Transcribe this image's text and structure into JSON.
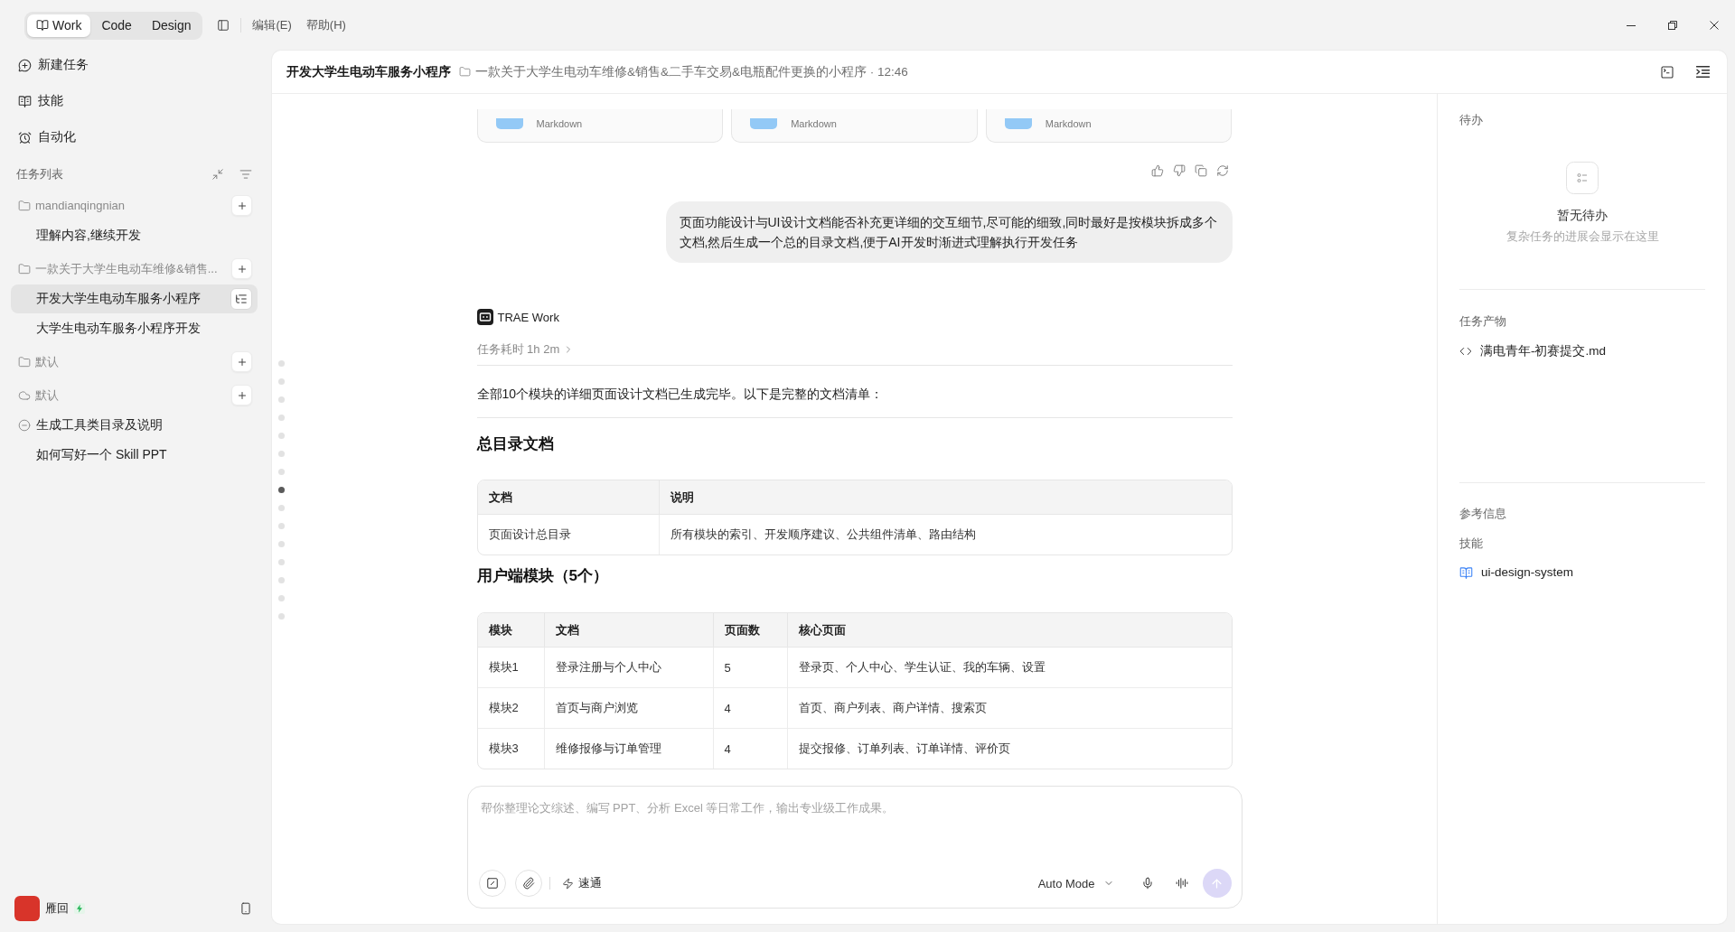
{
  "titlebar": {
    "modes": [
      {
        "label": "Work",
        "selected": true
      },
      {
        "label": "Code",
        "selected": false
      },
      {
        "label": "Design",
        "selected": false
      }
    ],
    "menus": [
      "编辑(E)",
      "帮助(H)"
    ]
  },
  "sidebar": {
    "nav": [
      {
        "label": "新建任务",
        "kind": "new_task"
      },
      {
        "label": "技能",
        "kind": "skills"
      },
      {
        "label": "自动化",
        "kind": "automation"
      }
    ],
    "task_list": {
      "title": "任务列表",
      "groups": [
        {
          "name": "mandianqingnian",
          "kind": "folder",
          "children": [
            {
              "label": "理解内容,继续开发",
              "kind": "plain",
              "selected": false
            }
          ]
        },
        {
          "name": "一款关于大学生电动车维修&销售...",
          "kind": "folder",
          "children": [
            {
              "label": "开发大学生电动车服务小程序",
              "kind": "plain",
              "selected": true
            },
            {
              "label": "大学生电动车服务小程序开发",
              "kind": "plain",
              "selected": false
            }
          ]
        },
        {
          "name": "默认",
          "kind": "folder"
        },
        {
          "name": "默认",
          "kind": "cloud",
          "children": [
            {
              "label": "生成工具类目录及说明",
              "kind": "stopped",
              "selected": false
            },
            {
              "label": "如何写好一个 Skill PPT",
              "kind": "plain",
              "selected": false
            }
          ]
        }
      ]
    },
    "user": {
      "name": "雁回"
    }
  },
  "header": {
    "title": "开发大学生电动车服务小程序",
    "subtitle": "一款关于大学生电动车维修&销售&二手车交易&电瓶配件更换的小程序 · 12:46"
  },
  "chat": {
    "attachments": [
      {
        "type": "Markdown"
      },
      {
        "type": "Markdown"
      },
      {
        "type": "Markdown"
      }
    ],
    "user_message": "页面功能设计与UI设计文档能否补充更详细的交互细节,尽可能的细致,同时最好是按模块拆成多个文档,然后生成一个总的目录文档,便于AI开发时渐进式理解执行开发任务",
    "assistant": {
      "name": "TRAE Work",
      "duration": "任务耗时 1h 2m",
      "intro": "全部10个模块的详细页面设计文档已生成完毕。以下是完整的文档清单：",
      "sections": [
        {
          "heading": "总目录文档",
          "table": {
            "columns": [
              "文档",
              "说明"
            ],
            "rows": [
              [
                "页面设计总目录",
                "所有模块的索引、开发顺序建议、公共组件清单、路由结构"
              ]
            ]
          }
        },
        {
          "heading": "用户端模块（5个）",
          "table": {
            "columns": [
              "模块",
              "文档",
              "页面数",
              "核心页面"
            ],
            "rows": [
              [
                "模块1",
                "登录注册与个人中心",
                "5",
                "登录页、个人中心、学生认证、我的车辆、设置"
              ],
              [
                "模块2",
                "首页与商户浏览",
                "4",
                "首页、商户列表、商户详情、搜索页"
              ],
              [
                "模块3",
                "维修报修与订单管理",
                "4",
                "提交报修、订单列表、订单详情、评价页"
              ]
            ]
          }
        }
      ]
    },
    "timeline": [
      {
        "selected": false
      },
      {
        "selected": false
      },
      {
        "selected": false
      },
      {
        "selected": false
      },
      {
        "selected": false
      },
      {
        "selected": false
      },
      {
        "selected": false
      },
      {
        "selected": true
      },
      {
        "selected": false
      },
      {
        "selected": false
      },
      {
        "selected": false
      },
      {
        "selected": false
      },
      {
        "selected": false
      },
      {
        "selected": false
      },
      {
        "selected": false
      }
    ]
  },
  "composer": {
    "placeholder": "帮你整理论文综述、编写 PPT、分析 Excel 等日常工作，输出专业级工作成果。",
    "speed": "速通",
    "mode": "Auto Mode"
  },
  "right_panel": {
    "todo": {
      "title": "待办",
      "empty_title": "暂无待办",
      "empty_hint": "复杂任务的进展会显示在这里"
    },
    "artifacts": {
      "title": "任务产物",
      "items": [
        "满电青年-初赛提交.md"
      ]
    },
    "references": {
      "title": "参考信息",
      "skills_title": "技能",
      "skills": [
        "ui-design-system"
      ]
    }
  }
}
